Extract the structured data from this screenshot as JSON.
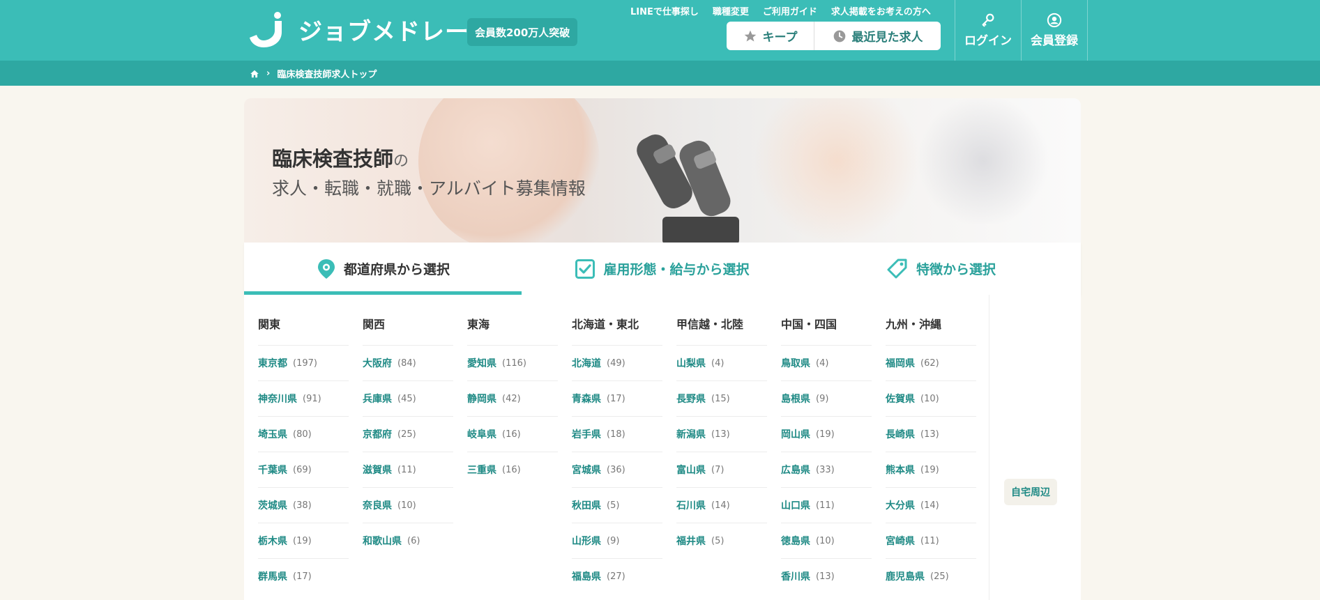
{
  "header": {
    "logo_text": "ジョブメドレー",
    "members_badge": "会員数200万人突破",
    "top_links": [
      "LINEで仕事探し",
      "職種変更",
      "ご利用ガイド",
      "求人掲載をお考えの方へ"
    ],
    "keep_label": "キープ",
    "recent_label": "最近見た求人",
    "login_label": "ログイン",
    "register_label": "会員登録"
  },
  "breadcrumb": {
    "current": "臨床検査技師求人トップ"
  },
  "hero": {
    "title": "臨床検査技師",
    "title_suffix": "の",
    "subtitle": "求人・転職・就職・アルバイト募集情報"
  },
  "tabs": [
    {
      "label": "都道府県から選択",
      "icon": "map-pin-icon",
      "active": true
    },
    {
      "label": "雇用形態・給与から選択",
      "icon": "checkbox-icon",
      "active": false
    },
    {
      "label": "特徴から選択",
      "icon": "tag-icon",
      "active": false
    }
  ],
  "regions": [
    {
      "name": "関東",
      "prefs": [
        {
          "name": "東京都",
          "count": "(197)"
        },
        {
          "name": "神奈川県",
          "count": "(91)"
        },
        {
          "name": "埼玉県",
          "count": "(80)"
        },
        {
          "name": "千葉県",
          "count": "(69)"
        },
        {
          "name": "茨城県",
          "count": "(38)"
        },
        {
          "name": "栃木県",
          "count": "(19)"
        },
        {
          "name": "群馬県",
          "count": "(17)"
        }
      ]
    },
    {
      "name": "関西",
      "prefs": [
        {
          "name": "大阪府",
          "count": "(84)"
        },
        {
          "name": "兵庫県",
          "count": "(45)"
        },
        {
          "name": "京都府",
          "count": "(25)"
        },
        {
          "name": "滋賀県",
          "count": "(11)"
        },
        {
          "name": "奈良県",
          "count": "(10)"
        },
        {
          "name": "和歌山県",
          "count": "(6)"
        }
      ]
    },
    {
      "name": "東海",
      "prefs": [
        {
          "name": "愛知県",
          "count": "(116)"
        },
        {
          "name": "静岡県",
          "count": "(42)"
        },
        {
          "name": "岐阜県",
          "count": "(16)"
        },
        {
          "name": "三重県",
          "count": "(16)"
        }
      ]
    },
    {
      "name": "北海道・東北",
      "prefs": [
        {
          "name": "北海道",
          "count": "(49)"
        },
        {
          "name": "青森県",
          "count": "(17)"
        },
        {
          "name": "岩手県",
          "count": "(18)"
        },
        {
          "name": "宮城県",
          "count": "(36)"
        },
        {
          "name": "秋田県",
          "count": "(5)"
        },
        {
          "name": "山形県",
          "count": "(9)"
        },
        {
          "name": "福島県",
          "count": "(27)"
        }
      ]
    },
    {
      "name": "甲信越・北陸",
      "prefs": [
        {
          "name": "山梨県",
          "count": "(4)"
        },
        {
          "name": "長野県",
          "count": "(15)"
        },
        {
          "name": "新潟県",
          "count": "(13)"
        },
        {
          "name": "富山県",
          "count": "(7)"
        },
        {
          "name": "石川県",
          "count": "(14)"
        },
        {
          "name": "福井県",
          "count": "(5)"
        }
      ]
    },
    {
      "name": "中国・四国",
      "prefs": [
        {
          "name": "鳥取県",
          "count": "(4)"
        },
        {
          "name": "島根県",
          "count": "(9)"
        },
        {
          "name": "岡山県",
          "count": "(19)"
        },
        {
          "name": "広島県",
          "count": "(33)"
        },
        {
          "name": "山口県",
          "count": "(11)"
        },
        {
          "name": "徳島県",
          "count": "(10)"
        },
        {
          "name": "香川県",
          "count": "(13)"
        }
      ]
    },
    {
      "name": "九州・沖縄",
      "prefs": [
        {
          "name": "福岡県",
          "count": "(62)"
        },
        {
          "name": "佐賀県",
          "count": "(10)"
        },
        {
          "name": "長崎県",
          "count": "(13)"
        },
        {
          "name": "熊本県",
          "count": "(19)"
        },
        {
          "name": "大分県",
          "count": "(14)"
        },
        {
          "name": "宮崎県",
          "count": "(11)"
        },
        {
          "name": "鹿児島県",
          "count": "(25)"
        }
      ]
    }
  ],
  "side": {
    "home_area_label": "自宅周辺"
  },
  "colors": {
    "brand": "#3bbdb7",
    "brand_dark": "#2ea8a2",
    "link": "#1f8a85",
    "background": "#f9f6ef"
  }
}
